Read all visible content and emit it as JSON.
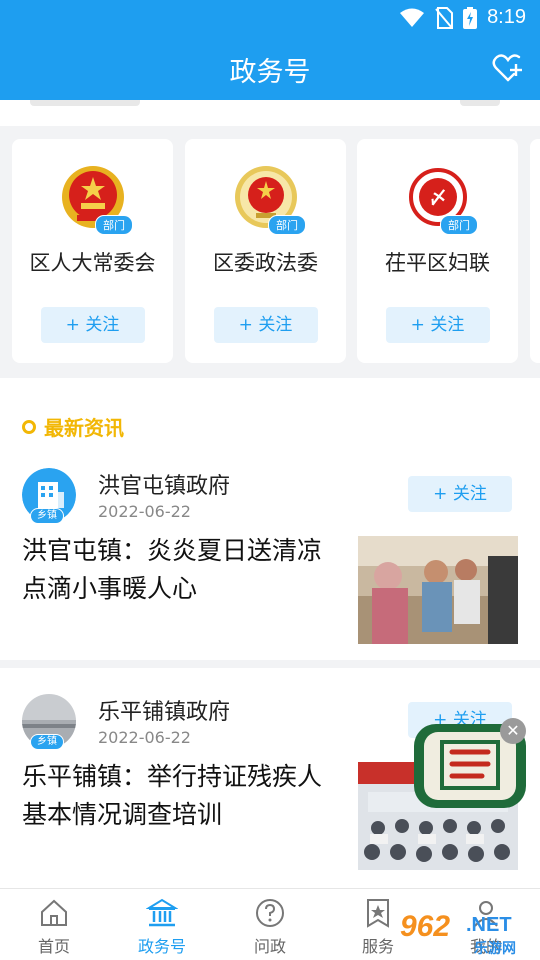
{
  "status_bar": {
    "time": "8:19",
    "icons": [
      "wifi-icon",
      "no-sim-icon",
      "battery-charging-icon"
    ]
  },
  "header": {
    "title": "政务号",
    "action_icon": "heart-plus-icon"
  },
  "departments": [
    {
      "name": "区人大常委会",
      "badge": "部门",
      "follow_label": "+ 关注",
      "emblem": "national-emblem"
    },
    {
      "name": "区委政法委",
      "badge": "部门",
      "follow_label": "+ 关注",
      "emblem": "politics-law-emblem"
    },
    {
      "name": "茌平区妇联",
      "badge": "部门",
      "follow_label": "+ 关注",
      "emblem": "womens-federation-emblem"
    }
  ],
  "news_section": {
    "title": "最新资讯"
  },
  "news": [
    {
      "org": "洪官屯镇政府",
      "badge": "乡镇",
      "date": "2022-06-22",
      "follow_label": "+ 关注",
      "headline": "洪官屯镇：炎炎夏日送清凉 点滴小事暖人心"
    },
    {
      "org": "乐平铺镇政府",
      "badge": "乡镇",
      "date": "2022-06-22",
      "follow_label": "+ 关注",
      "headline": "乐平铺镇：举行持证残疾人 基本情况调查培训"
    }
  ],
  "tabs": [
    {
      "label": "首页",
      "icon": "home-icon",
      "active": false
    },
    {
      "label": "政务号",
      "icon": "government-building-icon",
      "active": true
    },
    {
      "label": "问政",
      "icon": "question-circle-icon",
      "active": false
    },
    {
      "label": "服务",
      "icon": "star-bookmark-icon",
      "active": false
    },
    {
      "label": "我的",
      "icon": "user-icon",
      "active": false
    }
  ],
  "colors": {
    "brand": "#1e9ef0",
    "section_accent": "#f2b705",
    "badge": "#2aa3f0"
  },
  "watermark": {
    "num": "962",
    "net": ".NET",
    "cn": "乐游网"
  }
}
